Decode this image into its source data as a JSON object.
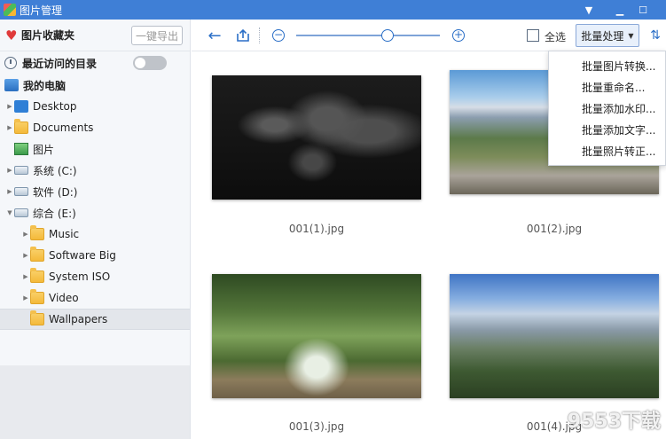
{
  "app": {
    "title": "图片管理"
  },
  "sidebar": {
    "favorites_label": "图片收藏夹",
    "export_label": "一键导出",
    "recent_label": "最近访问的目录",
    "computer_label": "我的电脑",
    "items": [
      {
        "label": "Desktop"
      },
      {
        "label": "Documents"
      },
      {
        "label": "图片"
      },
      {
        "label": "系统 (C:)"
      },
      {
        "label": "软件 (D:)"
      },
      {
        "label": "综合 (E:)"
      },
      {
        "label": "Music"
      },
      {
        "label": "Software Big"
      },
      {
        "label": "System ISO"
      },
      {
        "label": "Video"
      },
      {
        "label": "Wallpapers"
      }
    ]
  },
  "toolbar": {
    "select_all_label": "全选",
    "batch_label": "批量处理"
  },
  "batch_menu": [
    {
      "label": "批量图片转换..."
    },
    {
      "label": "批量重命名..."
    },
    {
      "label": "批量添加水印..."
    },
    {
      "label": "批量添加文字..."
    },
    {
      "label": "批量照片转正..."
    }
  ],
  "images": [
    {
      "caption": "001(1).jpg"
    },
    {
      "caption": "001(2).jpg"
    },
    {
      "caption": "001(3).jpg"
    },
    {
      "caption": "001(4).jpg"
    }
  ],
  "watermark": "9553下载"
}
